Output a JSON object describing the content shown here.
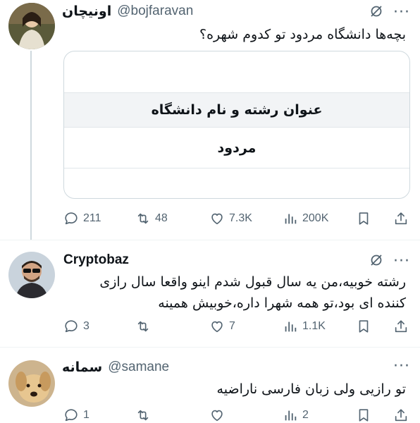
{
  "tweets": [
    {
      "display_name": "اونیچان",
      "handle": "@bojfaravan",
      "text": "بچه‌ها دانشگاه مردود تو کدوم شهره؟",
      "card": {
        "header": "عنوان رشته و نام دانشگاه",
        "row": "مردود"
      },
      "actions": {
        "replies": "211",
        "retweets": "48",
        "likes": "7.3K",
        "views": "200K"
      }
    },
    {
      "display_name": "Cryptobaz",
      "handle": "",
      "text": "رشته خوبیه،من یه سال قبول شدم اینو واقعا سال رازی کننده ای بود،تو همه شهرا داره،خوبیش همینه",
      "actions": {
        "replies": "3",
        "retweets": "",
        "likes": "7",
        "views": "1.1K"
      }
    },
    {
      "display_name": "سمانه",
      "handle": "@samane",
      "text": "تو رازیی ولی زبان فارسی ناراضیه",
      "actions": {
        "replies": "1",
        "retweets": "",
        "likes": "",
        "views": "2"
      }
    }
  ],
  "colors": {
    "icon_gray": "#536471",
    "text": "#0f1419",
    "border": "#cfd9de",
    "thread": "#cfd9de"
  },
  "icons": [
    "grok-icon",
    "more-icon",
    "reply-icon",
    "retweet-icon",
    "like-icon",
    "views-icon",
    "bookmark-icon",
    "share-icon"
  ]
}
